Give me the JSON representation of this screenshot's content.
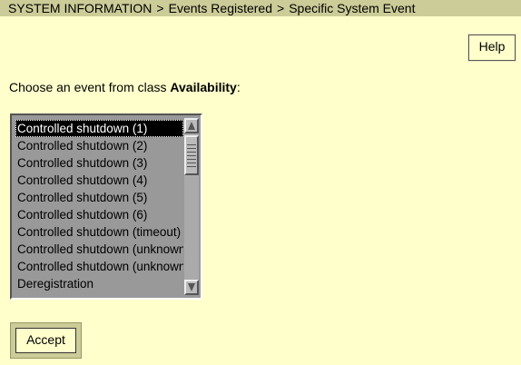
{
  "breadcrumb": {
    "items": [
      "SYSTEM INFORMATION",
      "Events Registered",
      "Specific System Event"
    ],
    "separator": ">"
  },
  "toolbar": {
    "help_label": "Help"
  },
  "prompt": {
    "prefix": "Choose an event from class ",
    "class_name": "Availability",
    "suffix": ":"
  },
  "event_list": {
    "selected_index": 0,
    "items": [
      "Controlled shutdown (1)",
      "Controlled shutdown (2)",
      "Controlled shutdown (3)",
      "Controlled shutdown (4)",
      "Controlled shutdown (5)",
      "Controlled shutdown (6)",
      "Controlled shutdown (timeout)",
      "Controlled shutdown (unknown)",
      "Controlled shutdown (unknown)",
      "Deregistration"
    ]
  },
  "actions": {
    "accept_label": "Accept"
  },
  "colors": {
    "background": "#ffffcc",
    "breadcrumb_bar": "#cccc99",
    "listbox_background": "#999999",
    "selected_background": "#000000",
    "selected_text": "#ffffff"
  }
}
